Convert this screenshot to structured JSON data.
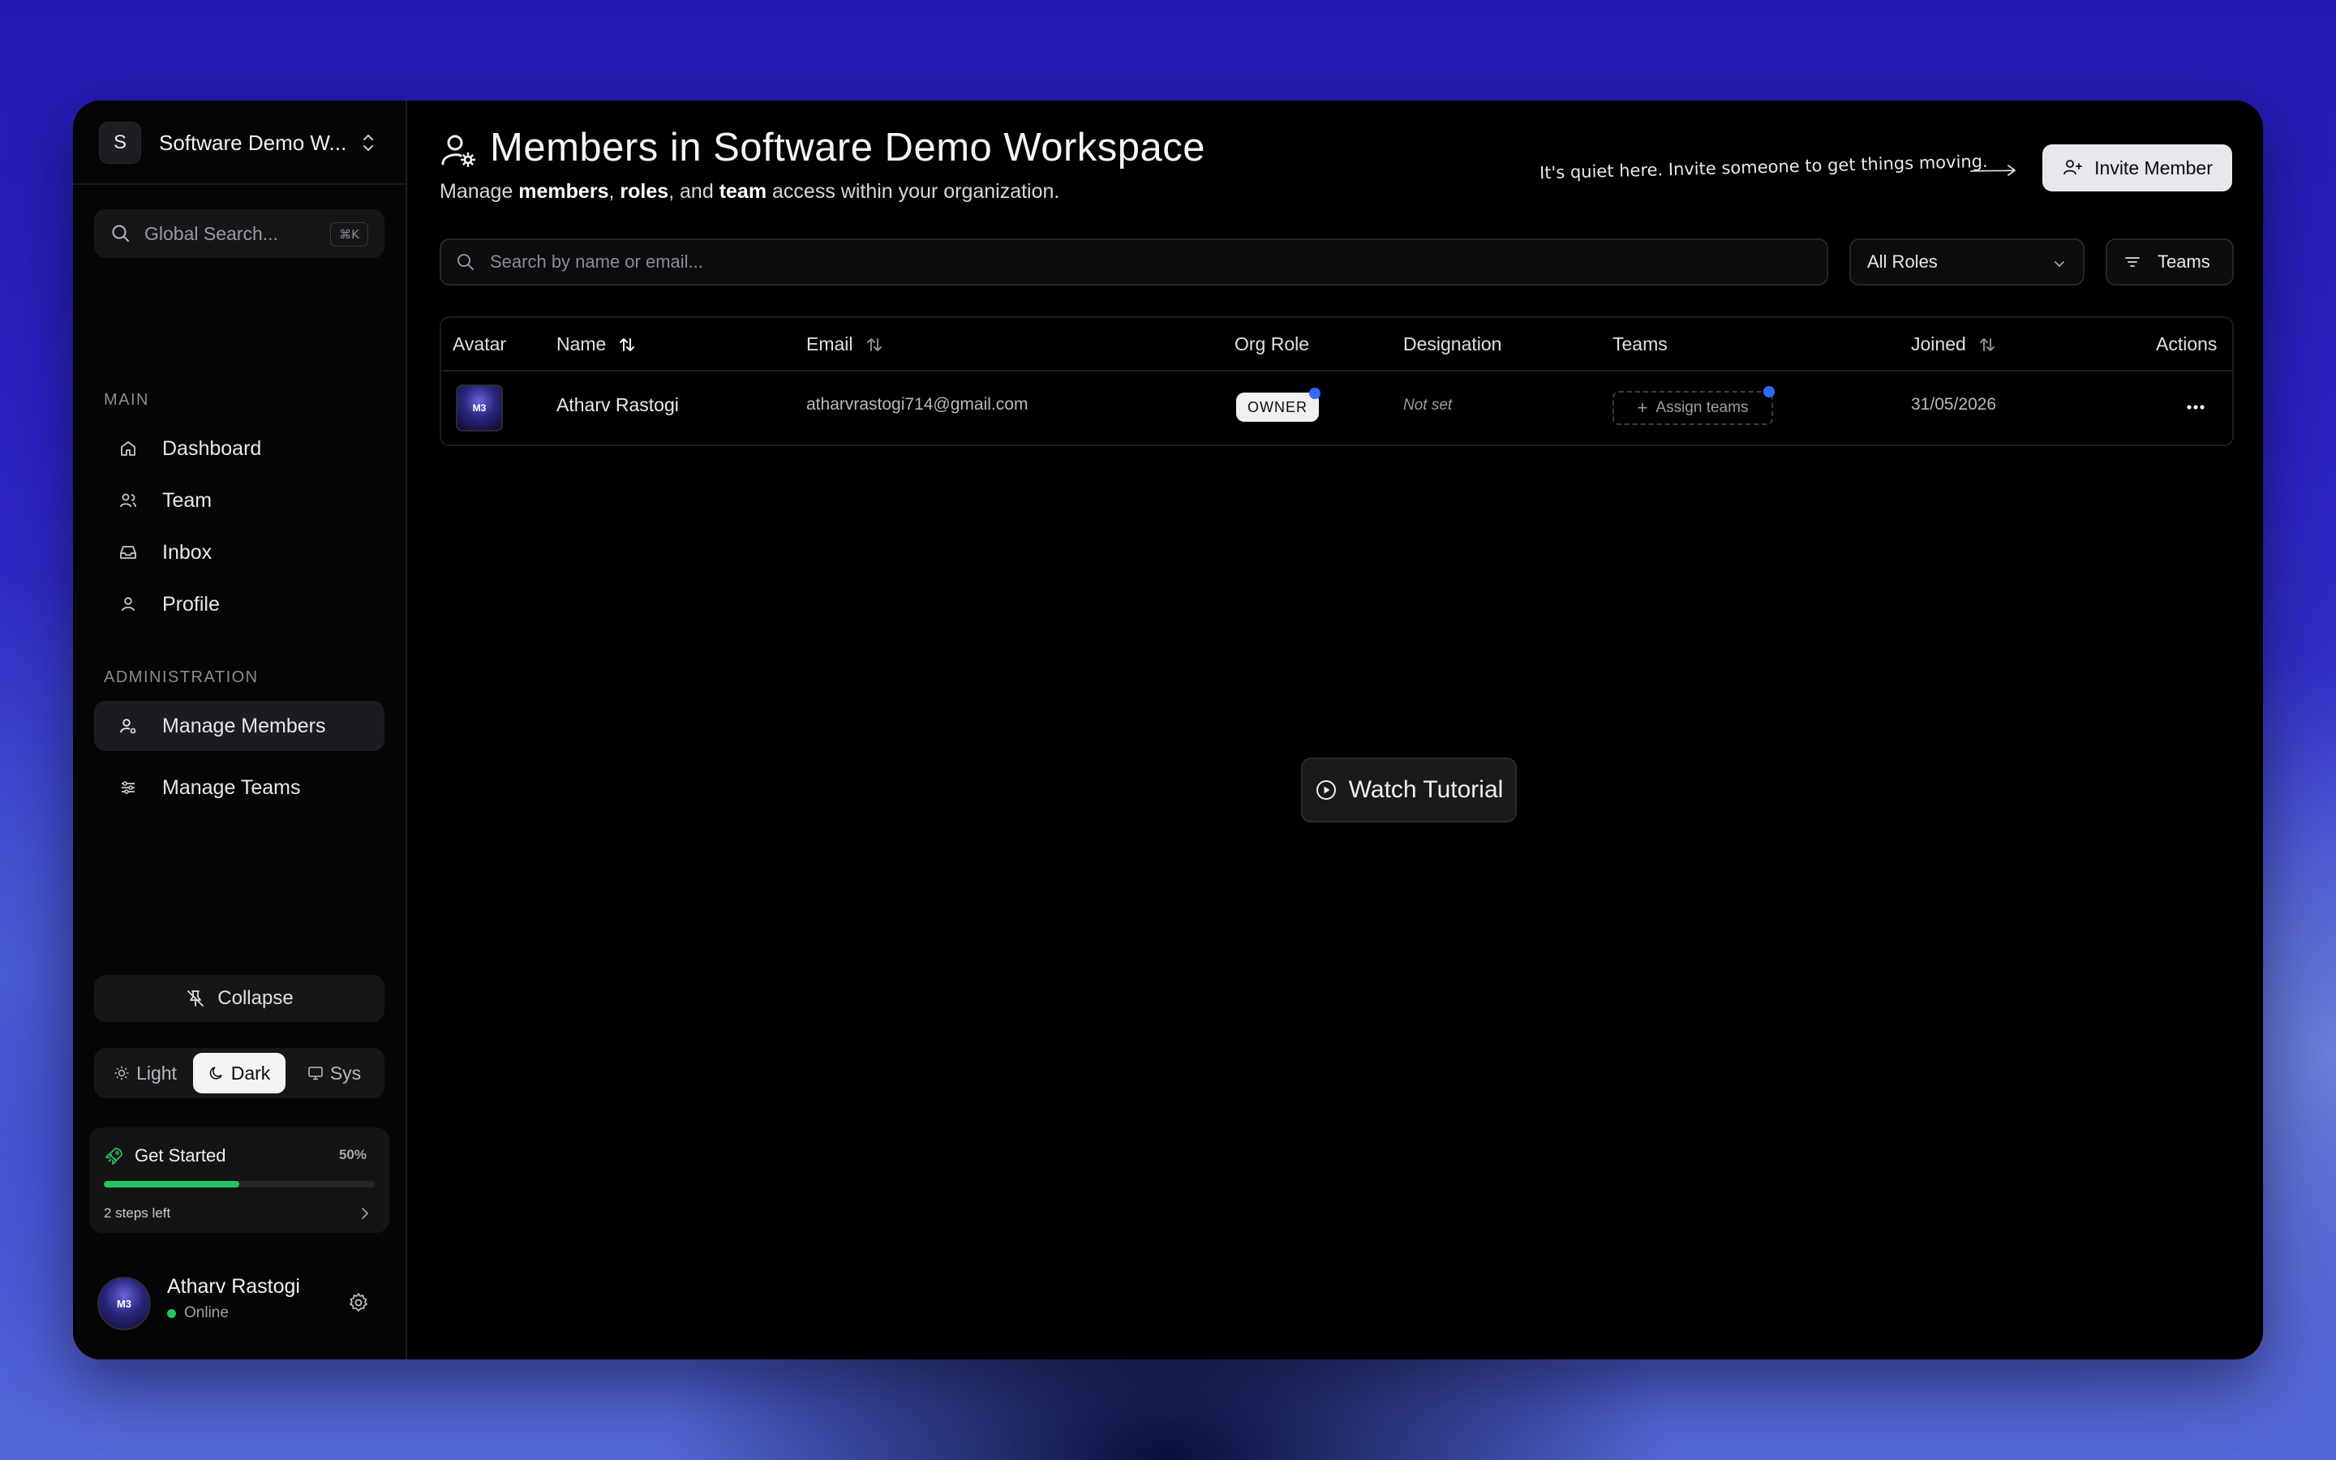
{
  "sidebar": {
    "workspace": {
      "initial": "S",
      "name": "Software Demo W..."
    },
    "search": {
      "placeholder": "Global Search...",
      "shortcut": "⌘K"
    },
    "main_label": "MAIN",
    "main_items": [
      {
        "label": "Dashboard",
        "icon": "home-icon"
      },
      {
        "label": "Team",
        "icon": "users-icon"
      },
      {
        "label": "Inbox",
        "icon": "inbox-icon"
      },
      {
        "label": "Profile",
        "icon": "user-icon"
      }
    ],
    "admin_label": "ADMINISTRATION",
    "admin_items": [
      {
        "label": "Manage Members",
        "icon": "user-cog-icon",
        "active": true
      },
      {
        "label": "Manage Teams",
        "icon": "sliders-icon"
      }
    ],
    "collapse_label": "Collapse",
    "theme": {
      "light": "Light",
      "dark": "Dark",
      "system": "Sys",
      "selected": "Dark"
    },
    "get_started": {
      "title": "Get Started",
      "percent": "50%",
      "progress": 0.5,
      "steps_left": "2 steps left"
    },
    "user": {
      "name": "Atharv Rastogi",
      "status": "Online",
      "avatar_text": "M3"
    }
  },
  "header": {
    "title": "Members in Software Demo Workspace",
    "subtitle_parts": [
      "Manage ",
      "members",
      ", ",
      "roles",
      ", and ",
      "team",
      " access within your organization."
    ],
    "quiet_note": "It's quiet here. Invite someone to get things moving.",
    "invite_label": "Invite Member"
  },
  "filters": {
    "search_placeholder": "Search by name or email...",
    "roles_selected": "All Roles",
    "teams_label": "Teams"
  },
  "table": {
    "columns": [
      "Avatar",
      "Name",
      "Email",
      "Org Role",
      "Designation",
      "Teams",
      "Joined",
      "Actions"
    ],
    "rows": [
      {
        "avatar_text": "M3",
        "name": "Atharv Rastogi",
        "email": "atharvrastogi714@gmail.com",
        "role": "OWNER",
        "designation": "Not set",
        "teams_action": "Assign teams",
        "joined": "31/05/2026"
      }
    ]
  },
  "tutorial_label": "Watch Tutorial",
  "colors": {
    "accent_green": "#22c55e",
    "notification_blue": "#2f6bff",
    "background": "#000000"
  }
}
